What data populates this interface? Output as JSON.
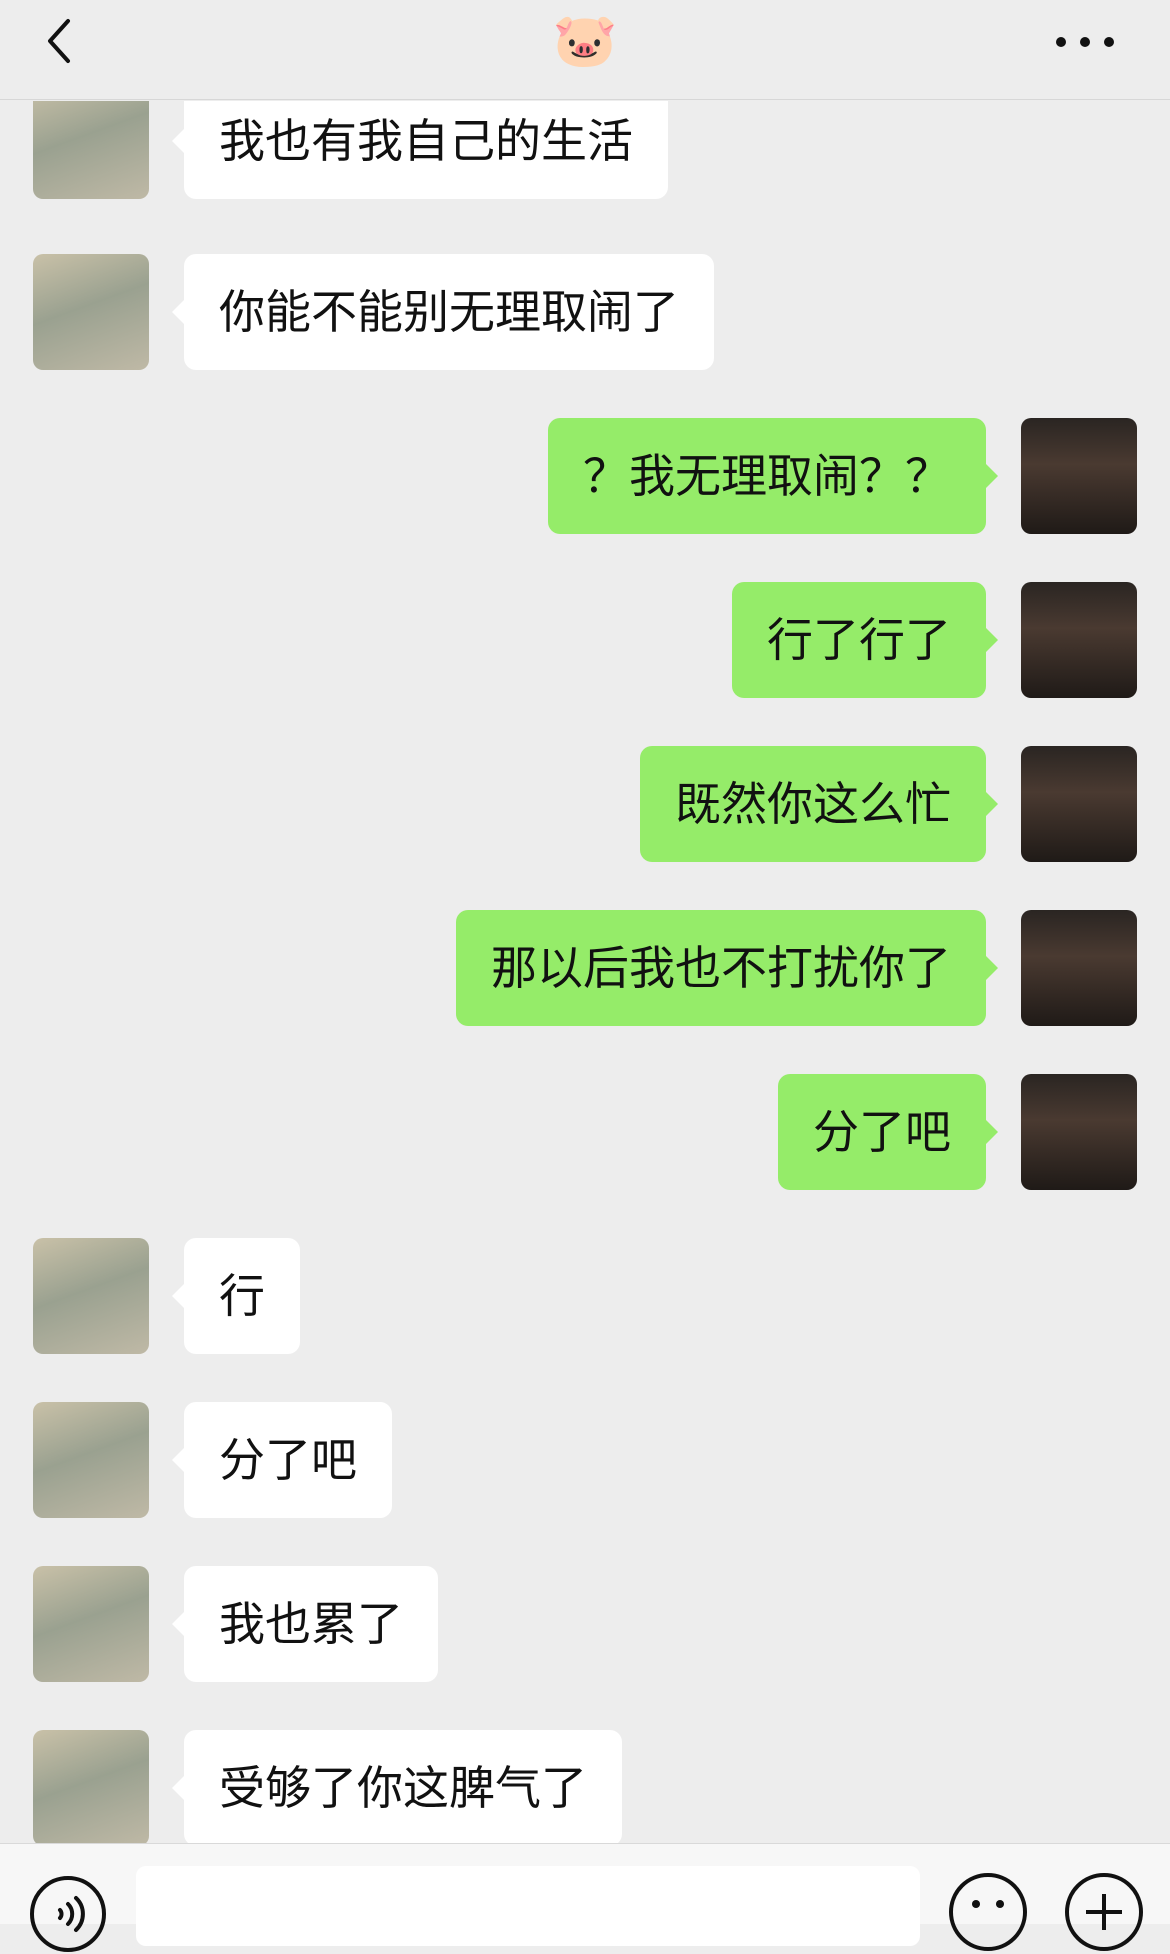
{
  "header": {
    "title": "🐷",
    "back_icon": "chevron-left-icon",
    "more_icon": "more-dots-icon"
  },
  "colors": {
    "background": "#ededed",
    "sent_bubble": "#95ec69",
    "received_bubble": "#ffffff"
  },
  "messages": [
    {
      "side": "left",
      "text": "我也有我自己的生活"
    },
    {
      "side": "left",
      "text": "你能不能别无理取闹了"
    },
    {
      "side": "right",
      "text": "？我无理取闹？？"
    },
    {
      "side": "right",
      "text": "行了行了"
    },
    {
      "side": "right",
      "text": "既然你这么忙"
    },
    {
      "side": "right",
      "text": "那以后我也不打扰你了"
    },
    {
      "side": "right",
      "text": "分了吧"
    },
    {
      "side": "left",
      "text": "行"
    },
    {
      "side": "left",
      "text": "分了吧"
    },
    {
      "side": "left",
      "text": "我也累了"
    },
    {
      "side": "left",
      "text": "受够了你这脾气了"
    }
  ],
  "bottom_bar": {
    "voice_icon": "voice-icon",
    "emoji_icon": "emoji-icon",
    "plus_icon": "plus-icon"
  }
}
